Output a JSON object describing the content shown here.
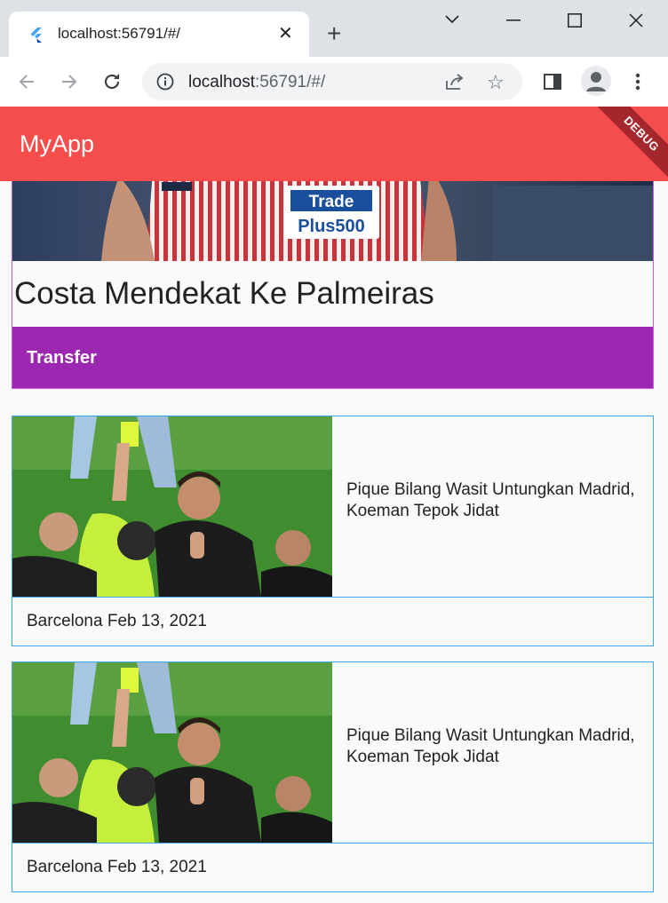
{
  "browser": {
    "tab_title": "localhost:56791/#/",
    "url_host": "localhost",
    "url_rest": ":56791/#/"
  },
  "app": {
    "title": "MyApp",
    "debug_label": "DEBUG"
  },
  "featured": {
    "jersey_sponsor_line1": "Trade",
    "jersey_sponsor_line2": "Plus500",
    "title": "Costa Mendekat Ke Palmeiras",
    "category": "Transfer"
  },
  "articles": [
    {
      "headline": "Pique Bilang Wasit Untungkan Madrid, Koeman Tepok Jidat",
      "footer": "Barcelona Feb 13, 2021"
    },
    {
      "headline": "Pique Bilang Wasit Untungkan Madrid, Koeman Tepok Jidat",
      "footer": "Barcelona Feb 13, 2021"
    }
  ],
  "colors": {
    "appbar": "#f44d4b",
    "category_bg": "#9c27b0",
    "card_border": "#42a5f5"
  },
  "icons": [
    "flutter-favicon",
    "close-icon",
    "plus-icon",
    "chevron-down-icon",
    "minimize-icon",
    "maximize-icon",
    "window-close-icon",
    "back-icon",
    "forward-icon",
    "reload-icon",
    "info-icon",
    "share-icon",
    "star-icon",
    "sidepanel-icon",
    "profile-icon",
    "more-vert-icon"
  ]
}
